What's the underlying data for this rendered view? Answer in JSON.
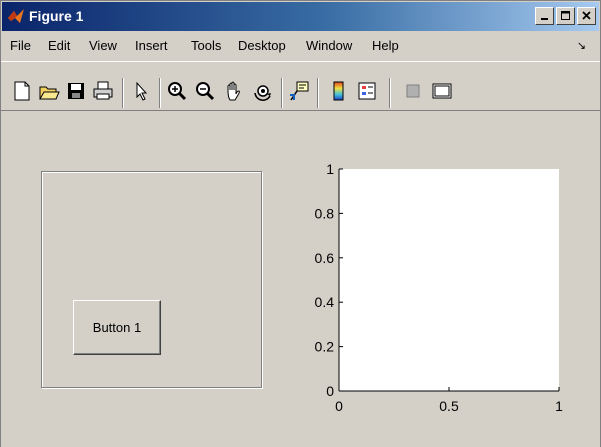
{
  "window": {
    "title": "Figure 1",
    "minimize_label": "_",
    "maximize_label": "□",
    "close_label": "×"
  },
  "menubar": {
    "items": [
      "File",
      "Edit",
      "View",
      "Insert",
      "Tools",
      "Desktop",
      "Window",
      "Help"
    ],
    "dock_arrow": "↘"
  },
  "toolbar": {
    "icons": [
      "new-figure-icon",
      "open-file-icon",
      "save-icon",
      "print-icon",
      "edit-plot-arrow-icon",
      "zoom-in-icon",
      "zoom-out-icon",
      "pan-hand-icon",
      "rotate-3d-icon",
      "data-cursor-icon",
      "insert-colorbar-icon",
      "insert-legend-icon",
      "hide-plot-tools-icon",
      "show-plot-tools-icon"
    ]
  },
  "figure": {
    "button_label": "Button 1",
    "axes": {
      "x_ticks": [
        "0",
        "0.5",
        "1"
      ],
      "y_ticks": [
        "0",
        "0.2",
        "0.4",
        "0.6",
        "0.8",
        "1"
      ]
    }
  }
}
